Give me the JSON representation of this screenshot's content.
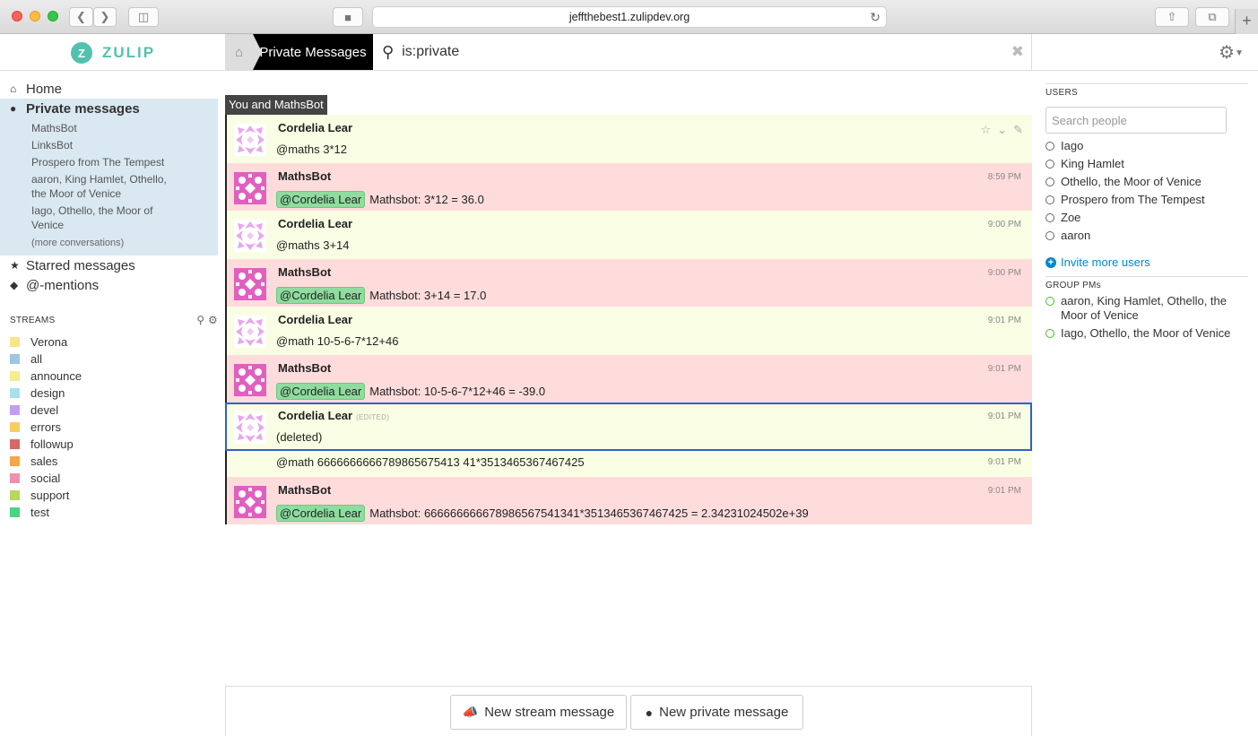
{
  "browser": {
    "url": "jeffthebest1.zulipdev.org"
  },
  "brand": {
    "logo_letter": "Z",
    "name": "ZULIP",
    "color": "#52c2af"
  },
  "header": {
    "crumb": "Private Messages",
    "search": "is:private"
  },
  "left": {
    "home": "Home",
    "pm": "Private messages",
    "conversations": [
      "MathsBot",
      "LinksBot",
      "Prospero from The Tempest",
      "aaron, King Hamlet, Othello, the Moor of Venice",
      "Iago, Othello, the Moor of Venice"
    ],
    "more": "(more conversations)",
    "starred": "Starred messages",
    "mentions": "@-mentions",
    "streams_title": "STREAMS",
    "streams": [
      {
        "name": "Verona",
        "color": "#f6e58d"
      },
      {
        "name": "all",
        "color": "#a0c4e4"
      },
      {
        "name": "announce",
        "color": "#f7ec8d"
      },
      {
        "name": "design",
        "color": "#a8e0ec"
      },
      {
        "name": "devel",
        "color": "#c39ef0"
      },
      {
        "name": "errors",
        "color": "#f5ce5e"
      },
      {
        "name": "followup",
        "color": "#d56868"
      },
      {
        "name": "sales",
        "color": "#f4a64a"
      },
      {
        "name": "social",
        "color": "#f08fb2"
      },
      {
        "name": "support",
        "color": "#b7d75e"
      },
      {
        "name": "test",
        "color": "#4cd285"
      }
    ]
  },
  "feed": {
    "recipient": "You and MathsBot",
    "messages": [
      {
        "sender": "Cordelia Lear",
        "time": "",
        "mention": "",
        "text": "@maths 3*12",
        "kind": "me"
      },
      {
        "sender": "MathsBot",
        "time": "8:59 PM",
        "mention": "@Cordelia Lear",
        "text": "Mathsbot: 3*12 = 36.0",
        "kind": "bot"
      },
      {
        "sender": "Cordelia Lear",
        "time": "9:00 PM",
        "mention": "",
        "text": "@maths 3+14",
        "kind": "me"
      },
      {
        "sender": "MathsBot",
        "time": "9:00 PM",
        "mention": "@Cordelia Lear",
        "text": "Mathsbot: 3+14 = 17.0",
        "kind": "bot"
      },
      {
        "sender": "Cordelia Lear",
        "time": "9:01 PM",
        "mention": "",
        "text": "@math 10-5-6-7*12+46",
        "kind": "me"
      },
      {
        "sender": "MathsBot",
        "time": "9:01 PM",
        "mention": "@Cordelia Lear",
        "text": "Mathsbot: 10-5-6-7*12+46 = -39.0",
        "kind": "bot"
      },
      {
        "sender": "Cordelia Lear",
        "time": "9:01 PM",
        "mention": "",
        "text": "(deleted)",
        "kind": "me",
        "edited": "(EDITED)"
      },
      {
        "sender": "",
        "time": "9:01 PM",
        "mention": "",
        "text": "@math 6666666666789865675413 41*3513465367467425",
        "kind": "cont"
      },
      {
        "sender": "MathsBot",
        "time": "9:01 PM",
        "mention": "@Cordelia Lear",
        "text": "Mathsbot: 666666666678986567541341*3513465367467425 = 2.34231024502e+39",
        "kind": "bot"
      }
    ]
  },
  "right": {
    "users_title": "USERS",
    "search_placeholder": "Search people",
    "users": [
      "Iago",
      "King Hamlet",
      "Othello, the Moor of Venice",
      "Prospero from The Tempest",
      "Zoe",
      "aaron"
    ],
    "invite": "Invite more users",
    "group_title": "GROUP PMs",
    "groups": [
      "aaron, King Hamlet, Othello, the Moor of Venice",
      "Iago, Othello, the Moor of Venice"
    ]
  },
  "compose": {
    "stream_btn": "New stream message",
    "private_btn": "New private message"
  }
}
